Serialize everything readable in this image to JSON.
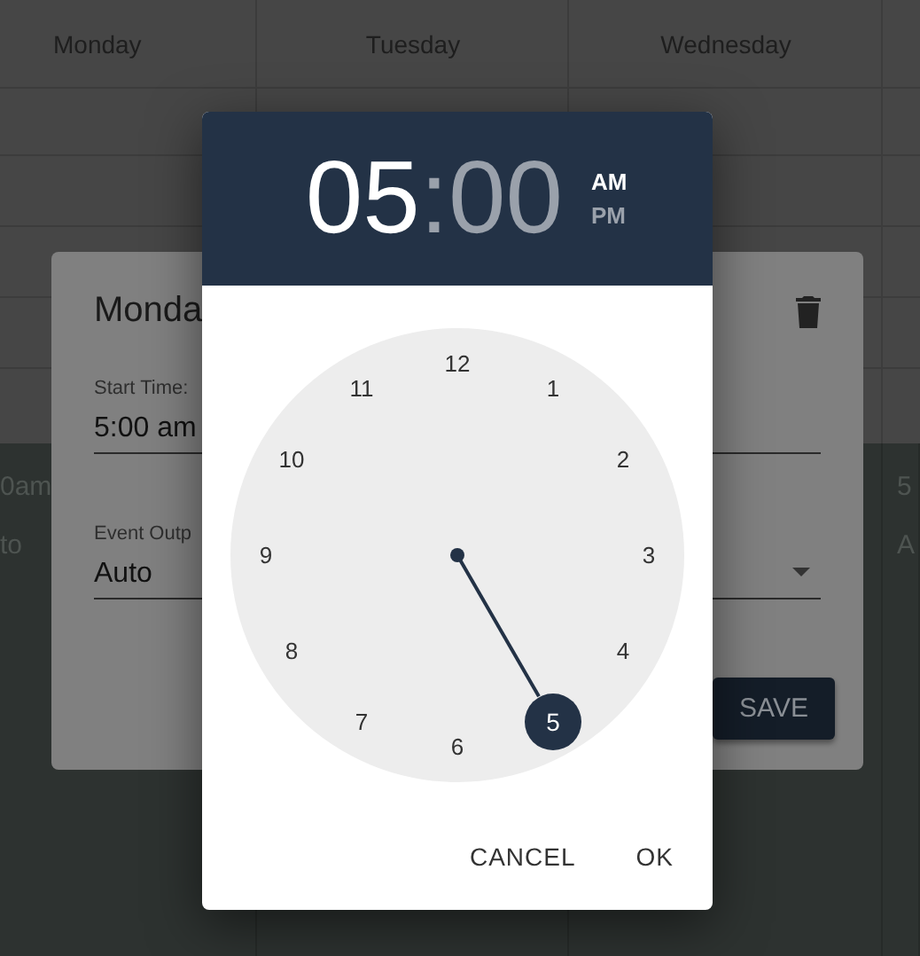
{
  "calendar": {
    "columns": [
      {
        "label": "Monday",
        "cells": [
          "0am",
          "to"
        ]
      },
      {
        "label": "Tuesday"
      },
      {
        "label": "Wednesday"
      },
      {
        "cells": [
          "5",
          "A"
        ]
      }
    ]
  },
  "event_dialog": {
    "title": "Monda",
    "fields": [
      {
        "kind": "text",
        "label": "Start Time:",
        "value": "5:00 am"
      },
      {
        "kind": "select",
        "label": "Event Outp",
        "value": "Auto"
      }
    ],
    "save_button": "SAVE"
  },
  "time_picker": {
    "hour": {
      "text": "05",
      "selected": true
    },
    "separator": ":",
    "minute": {
      "text": "00",
      "selected": false
    },
    "periods": [
      {
        "label": "AM",
        "selected": true
      },
      {
        "label": "PM",
        "selected": false
      }
    ],
    "dial": [
      {
        "label": "12",
        "selected": false
      },
      {
        "label": "1",
        "selected": false
      },
      {
        "label": "2",
        "selected": false
      },
      {
        "label": "3",
        "selected": false
      },
      {
        "label": "4",
        "selected": false
      },
      {
        "label": "5",
        "selected": true
      },
      {
        "label": "6",
        "selected": false
      },
      {
        "label": "7",
        "selected": false
      },
      {
        "label": "8",
        "selected": false
      },
      {
        "label": "9",
        "selected": false
      },
      {
        "label": "10",
        "selected": false
      },
      {
        "label": "11",
        "selected": false
      }
    ],
    "buttons": [
      "CANCEL",
      "OK"
    ]
  }
}
